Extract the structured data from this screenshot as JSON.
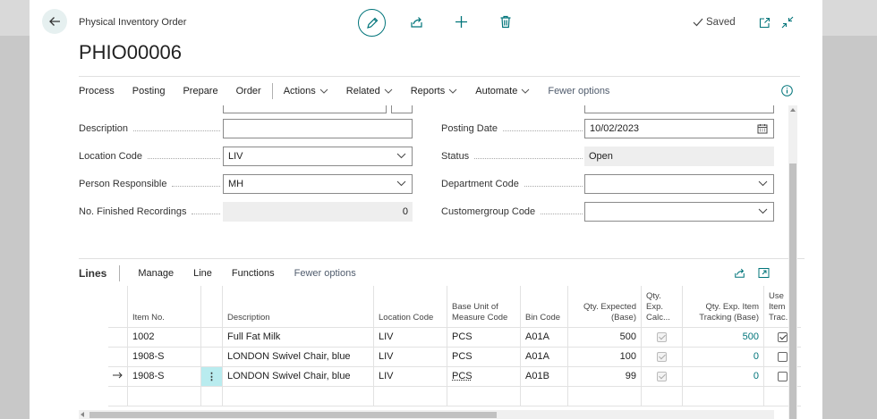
{
  "header": {
    "page_type": "Physical Inventory Order",
    "page_id": "PHIO00006",
    "saved_label": "Saved"
  },
  "actions": [
    {
      "label": "Process"
    },
    {
      "label": "Posting"
    },
    {
      "label": "Prepare"
    },
    {
      "label": "Order"
    },
    {
      "label": "Actions"
    },
    {
      "label": "Related"
    },
    {
      "label": "Reports"
    },
    {
      "label": "Automate"
    },
    {
      "label": "Fewer options"
    }
  ],
  "fields": {
    "description": {
      "label": "Description",
      "value": ""
    },
    "location_code": {
      "label": "Location Code",
      "value": "LIV"
    },
    "person_responsible": {
      "label": "Person Responsible",
      "value": "MH"
    },
    "no_finished_recordings": {
      "label": "No. Finished Recordings",
      "value": "0"
    },
    "posting_date": {
      "label": "Posting Date",
      "value": "10/02/2023"
    },
    "status": {
      "label": "Status",
      "value": "Open"
    },
    "department_code": {
      "label": "Department Code",
      "value": ""
    },
    "customergroup_code": {
      "label": "Customergroup Code",
      "value": ""
    }
  },
  "lines": {
    "title": "Lines",
    "actions": [
      "Manage",
      "Line",
      "Functions",
      "Fewer options"
    ],
    "columns": {
      "item_no": "Item No.",
      "description": "Description",
      "location_code": "Location Code",
      "base_uom": "Base Unit of Measure Code",
      "bin_code": "Bin Code",
      "qty_expected": "Qty. Expected (Base)",
      "qty_exp_calc": "Qty. Exp. Calc...",
      "qty_exp_tracking": "Qty. Exp. Item Tracking (Base)",
      "use_item_tracking": "Use Item Trac..."
    },
    "rows": [
      {
        "item_no": "1002",
        "description": "Full Fat Milk",
        "location_code": "LIV",
        "uom": "PCS",
        "bin": "A01A",
        "qty_expected": "500",
        "qty_exp_calc": true,
        "qty_exp_tracking": "500",
        "use_tracking": true
      },
      {
        "item_no": "1908-S",
        "description": "LONDON Swivel Chair, blue",
        "location_code": "LIV",
        "uom": "PCS",
        "bin": "A01A",
        "qty_expected": "100",
        "qty_exp_calc": true,
        "qty_exp_tracking": "0",
        "use_tracking": false
      },
      {
        "item_no": "1908-S",
        "description": "LONDON Swivel Chair, blue",
        "location_code": "LIV",
        "uom": "PCS",
        "bin": "A01B",
        "qty_expected": "99",
        "qty_exp_calc": true,
        "qty_exp_tracking": "0",
        "use_tracking": false
      }
    ]
  },
  "colors": {
    "accent": "#00747a",
    "selected_cell": "#b9ecef"
  }
}
